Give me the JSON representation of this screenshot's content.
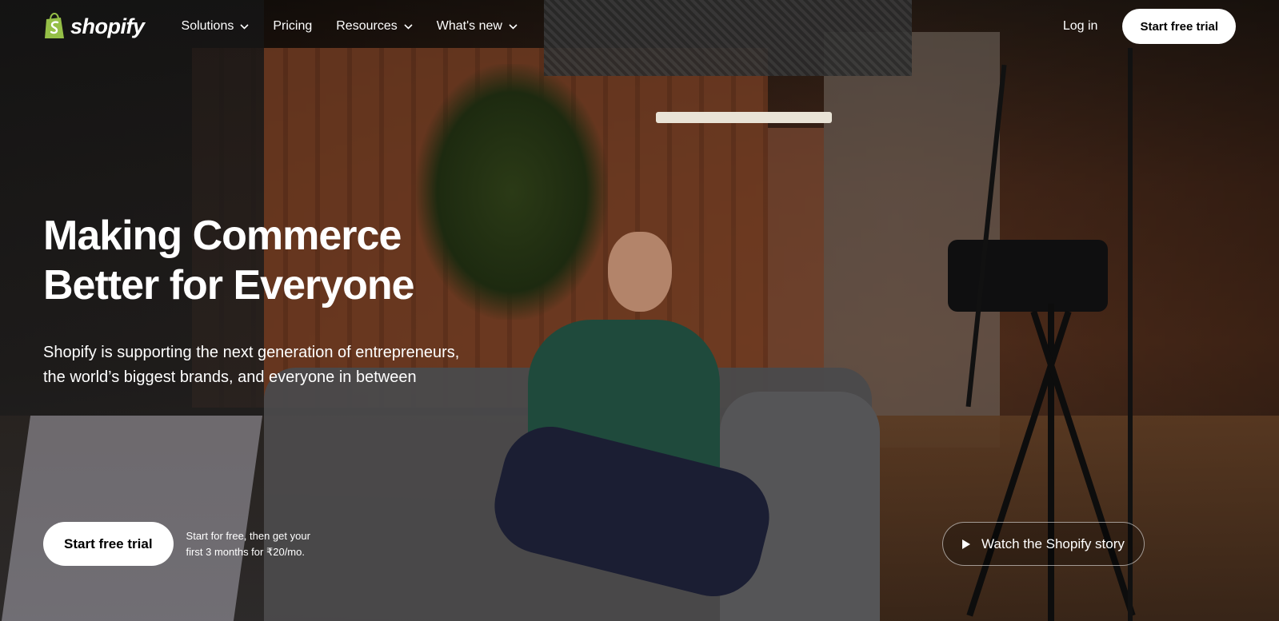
{
  "brand": {
    "name": "shopify",
    "color": "#95bf47"
  },
  "nav": {
    "items": [
      {
        "label": "Solutions",
        "has_dropdown": true
      },
      {
        "label": "Pricing",
        "has_dropdown": false
      },
      {
        "label": "Resources",
        "has_dropdown": true
      },
      {
        "label": "What's new",
        "has_dropdown": true
      }
    ],
    "login": "Log in",
    "cta": "Start free trial"
  },
  "hero": {
    "title_line1": "Making Commerce",
    "title_line2": "Better for Everyone",
    "subtitle_line1": "Shopify is supporting the next generation of entrepreneurs,",
    "subtitle_line2": "the world’s biggest brands, and everyone in between",
    "cta": "Start free trial",
    "note_line1": "Start for free, then get your",
    "note_line2": "first 3 months for ₹20/mo.",
    "watch": "Watch the Shopify story"
  },
  "icons": {
    "logo": "shopping-bag-icon",
    "dropdown": "chevron-down-icon",
    "play": "play-icon"
  }
}
